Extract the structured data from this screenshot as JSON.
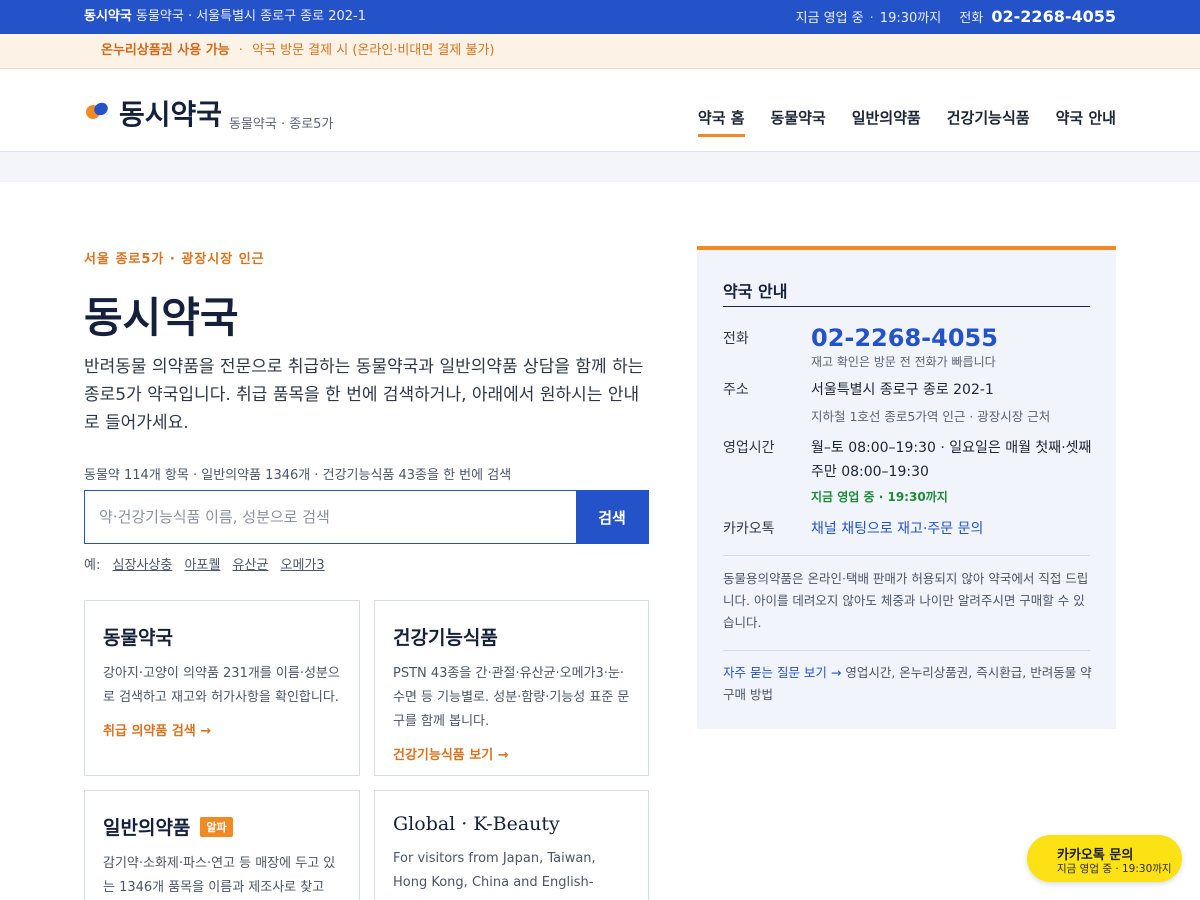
{
  "topbar": {
    "name": "동시약국",
    "info": "동물약국 · 서울특별시 종로구 종로 202-1",
    "status": "지금 영업 중",
    "hours": "19:30까지",
    "phone_label": "전화",
    "phone": "02-2268-4055"
  },
  "notice": {
    "highlight": "온누리상품권 사용 가능",
    "text": "약국 방문 결제 시 (온라인·비대면 결제 불가)"
  },
  "header": {
    "brand": "동시약국",
    "sub": "동물약국 · 종로5가",
    "nav": [
      "약국 홈",
      "동물약국",
      "일반의약품",
      "건강기능식품",
      "약국 안내"
    ]
  },
  "hero": {
    "eyebrow": "서울 종로5가 · 광장시장 인근",
    "title": "동시약국",
    "desc": "반려동물 의약품을 전문으로 취급하는 동물약국과 일반의약품 상담을 함께 하는 종로5가 약국입니다. 취급 품목을 한 번에 검색하거나, 아래에서 원하시는 안내로 들어가세요."
  },
  "search": {
    "meta": "동물약 114개 항목 · 일반의약품 1346개 · 건강기능식품 43종을 한 번에 검색",
    "placeholder": "약·건강기능식품 이름, 성분으로 검색",
    "button": "검색",
    "examples_label": "예:",
    "examples": [
      "심장사상충",
      "아포퀠",
      "유산균",
      "오메가3"
    ]
  },
  "cards": [
    {
      "title": "동물약국",
      "desc": "강아지·고양이 의약품 231개를 이름·성분으로 검색하고 재고와 허가사항을 확인합니다.",
      "link": "취급 의약품 검색 →"
    },
    {
      "title": "건강기능식품",
      "desc": "PSTN 43종을 간·관절·유산균·오메가3·눈·수면 등 기능별로. 성분·함량·기능성 표준 문구를 함께 봅니다.",
      "link": "건강기능식품 보기 →"
    },
    {
      "title": "일반의약품",
      "badge": "알파",
      "desc": "감기약·소화제·파스·연고 등 매장에 두고 있는 1346개 품목을 이름과 제조사로 찾고"
    },
    {
      "title": "Global · K-Beauty",
      "desc": "For visitors from Japan, Taiwan, Hong Kong, China and English-speaking"
    }
  ],
  "panel": {
    "title": "약국 안내",
    "phone_label": "전화",
    "phone": "02-2268-4055",
    "phone_note": "재고 확인은 방문 전 전화가 빠릅니다",
    "address_label": "주소",
    "address": "서울특별시 종로구 종로 202-1",
    "address_note": "지하철 1호선 종로5가역 인근 · 광장시장 근처",
    "hours_label": "영업시간",
    "hours_line1": "월–토 08:00–19:30 · 일요일은 매월 첫째·셋째",
    "hours_line2": "주만 08:00–19:30",
    "hours_status": "지금 영업 중 · 19:30까지",
    "kakao_label": "카카오톡",
    "kakao_link": "채널 채팅으로 재고·주문 문의",
    "note": "동물용의약품은 온라인·택배 판매가 허용되지 않아 약국에서 직접 드립니다. 아이를 데려오지 않아도 체중과 나이만 알려주시면 구매할 수 있습니다.",
    "faq_link": "자주 묻는 질문 보기 →",
    "faq_text": "영업시간, 온누리상품권, 즉시환급, 반려동물 약 구매 방법"
  },
  "kakao_float": {
    "label": "카카오톡 문의",
    "status": "지금 영업 중 · 19:30까지"
  },
  "colors": {
    "primary": "#2452c9",
    "accent": "#f08a24",
    "open_green": "#1f8a3a",
    "kakao_yellow": "#fce215"
  }
}
